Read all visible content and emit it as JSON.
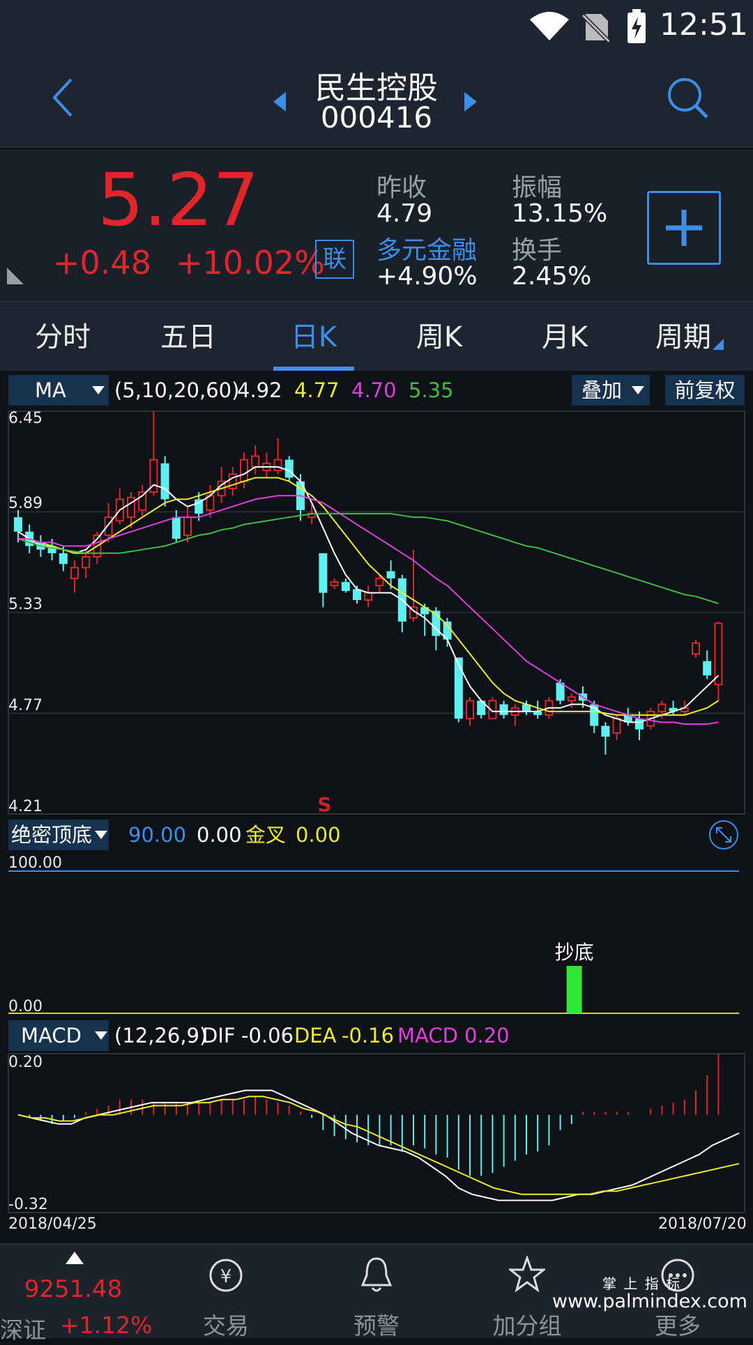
{
  "status": {
    "time": "12:51"
  },
  "header": {
    "stock_name": "民生控股",
    "stock_code": "000416"
  },
  "quote": {
    "price": "5.27",
    "change": "+0.48",
    "change_pct": "+10.02%",
    "lian_badge": "联",
    "prev_close_label": "昨收",
    "prev_close": "4.79",
    "amplitude_label": "振幅",
    "amplitude": "13.15%",
    "sector_label": "多元金融",
    "sector_pct": "+4.90%",
    "turnover_label": "换手",
    "turnover": "2.45%",
    "up_color": "#e0262b",
    "accent": "#3c8ee6"
  },
  "tabs": [
    "分时",
    "五日",
    "日K",
    "周K",
    "月K",
    "周期"
  ],
  "active_tab": "日K",
  "ma_bar": {
    "select": "MA",
    "params": "(5,10,20,60)",
    "ma5": "4.92",
    "ma10": "4.77",
    "ma20": "4.70",
    "ma60": "5.35",
    "overlay_button": "叠加",
    "rights_button": "前复权"
  },
  "main_axis": {
    "ticks": [
      "6.45",
      "5.89",
      "5.33",
      "4.77",
      "4.21"
    ]
  },
  "signal_marker": "S",
  "indicator_bar": {
    "select": "绝密顶底",
    "v1": "90.00",
    "v2": "0.00",
    "golden_cross_label": "金叉",
    "v3": "0.00",
    "axis_top": "100.00",
    "axis_bottom": "0.00",
    "buy_label": "抄底"
  },
  "macd_bar": {
    "select": "MACD",
    "params": "(12,26,9)",
    "dif_label": "DIF",
    "dif": "-0.06",
    "dea_label": "DEA",
    "dea": "-0.16",
    "macd_label": "MACD",
    "macd": "0.20",
    "axis_top": "0.20",
    "axis_bottom": "-0.32"
  },
  "date_range": {
    "start": "2018/04/25",
    "end": "2018/07/20"
  },
  "bottom_nav": {
    "index_value": "9251.48",
    "index_name": "深证",
    "index_pct": "+1.12%",
    "items": [
      "交易",
      "预警",
      "加分组",
      "更多"
    ]
  },
  "watermark": {
    "line1": "掌 上 指 标",
    "line2": "www.palmindex.com"
  },
  "chart_data": {
    "type": "candlestick",
    "ylim": [
      4.21,
      6.45
    ],
    "candles": [
      [
        5.86,
        5.78,
        5.9,
        5.72
      ],
      [
        5.78,
        5.7,
        5.82,
        5.66
      ],
      [
        5.72,
        5.68,
        5.76,
        5.64
      ],
      [
        5.7,
        5.66,
        5.74,
        5.62
      ],
      [
        5.66,
        5.6,
        5.7,
        5.56
      ],
      [
        5.52,
        5.58,
        5.62,
        5.44
      ],
      [
        5.58,
        5.64,
        5.68,
        5.52
      ],
      [
        5.64,
        5.76,
        5.78,
        5.6
      ],
      [
        5.76,
        5.86,
        5.94,
        5.72
      ],
      [
        5.84,
        5.96,
        6.02,
        5.82
      ],
      [
        5.86,
        5.97,
        6.0,
        5.8
      ],
      [
        5.9,
        6.0,
        6.04,
        5.86
      ],
      [
        6.0,
        6.18,
        6.45,
        5.98
      ],
      [
        6.16,
        5.96,
        6.2,
        5.92
      ],
      [
        5.86,
        5.74,
        5.9,
        5.72
      ],
      [
        5.76,
        5.86,
        5.92,
        5.72
      ],
      [
        5.96,
        5.88,
        6.0,
        5.84
      ],
      [
        5.9,
        5.98,
        6.04,
        5.86
      ],
      [
        5.98,
        6.06,
        6.14,
        5.94
      ],
      [
        6.02,
        6.1,
        6.14,
        5.98
      ],
      [
        6.06,
        6.18,
        6.22,
        6.02
      ],
      [
        6.14,
        6.2,
        6.26,
        6.1
      ],
      [
        6.12,
        6.16,
        6.22,
        6.08
      ],
      [
        6.12,
        6.18,
        6.3,
        6.1
      ],
      [
        6.18,
        6.08,
        6.2,
        6.06
      ],
      [
        6.06,
        5.9,
        6.1,
        5.84
      ],
      [
        5.86,
        5.88,
        5.94,
        5.82
      ],
      [
        5.66,
        5.44,
        5.66,
        5.36
      ],
      [
        5.48,
        5.5,
        5.52,
        5.46
      ],
      [
        5.5,
        5.45,
        5.52,
        5.44
      ],
      [
        5.46,
        5.4,
        5.48,
        5.38
      ],
      [
        5.4,
        5.44,
        5.48,
        5.36
      ],
      [
        5.48,
        5.52,
        5.54,
        5.44
      ],
      [
        5.56,
        5.52,
        5.62,
        5.46
      ],
      [
        5.52,
        5.28,
        5.54,
        5.22
      ],
      [
        5.3,
        5.36,
        5.68,
        5.28
      ],
      [
        5.36,
        5.32,
        5.38,
        5.2
      ],
      [
        5.34,
        5.2,
        5.36,
        5.12
      ],
      [
        5.28,
        5.18,
        5.3,
        5.14
      ],
      [
        5.08,
        4.74,
        5.08,
        4.72
      ],
      [
        4.74,
        4.84,
        4.86,
        4.7
      ],
      [
        4.84,
        4.76,
        4.84,
        4.74
      ],
      [
        4.74,
        4.84,
        4.86,
        4.74
      ],
      [
        4.82,
        4.76,
        4.84,
        4.74
      ],
      [
        4.76,
        4.8,
        4.82,
        4.7
      ],
      [
        4.82,
        4.78,
        4.84,
        4.76
      ],
      [
        4.78,
        4.76,
        4.84,
        4.74
      ],
      [
        4.76,
        4.84,
        4.86,
        4.74
      ],
      [
        4.94,
        4.84,
        4.96,
        4.82
      ],
      [
        4.84,
        4.86,
        4.88,
        4.8
      ],
      [
        4.88,
        4.84,
        4.92,
        4.8
      ],
      [
        4.82,
        4.7,
        4.84,
        4.66
      ],
      [
        4.7,
        4.64,
        4.72,
        4.54
      ],
      [
        4.66,
        4.74,
        4.76,
        4.62
      ],
      [
        4.76,
        4.72,
        4.8,
        4.7
      ],
      [
        4.74,
        4.68,
        4.78,
        4.62
      ],
      [
        4.7,
        4.78,
        4.8,
        4.68
      ],
      [
        4.78,
        4.82,
        4.84,
        4.74
      ],
      [
        4.8,
        4.78,
        4.84,
        4.76
      ],
      [
        4.78,
        4.8,
        4.84,
        4.76
      ],
      [
        5.1,
        5.16,
        5.18,
        5.08
      ],
      [
        5.06,
        4.98,
        5.12,
        4.96
      ],
      [
        4.93,
        5.27,
        5.28,
        4.84
      ]
    ],
    "ma5": [
      5.78,
      5.74,
      5.7,
      5.7,
      5.68,
      5.66,
      5.68,
      5.74,
      5.82,
      5.9,
      5.94,
      5.98,
      6.04,
      6.02,
      5.96,
      5.92,
      5.94,
      5.98,
      6.04,
      6.08,
      6.1,
      6.14,
      6.14,
      6.14,
      6.12,
      6.06,
      5.94,
      5.8,
      5.66,
      5.54,
      5.46,
      5.44,
      5.44,
      5.44,
      5.4,
      5.34,
      5.3,
      5.24,
      5.18,
      5.04,
      4.92,
      4.84,
      4.78,
      4.78,
      4.78,
      4.78,
      4.78,
      4.8,
      4.8,
      4.82,
      4.82,
      4.8,
      4.76,
      4.74,
      4.72,
      4.72,
      4.74,
      4.76,
      4.78,
      4.8,
      4.86,
      4.92,
      4.98
    ],
    "ma10": [
      5.74,
      5.74,
      5.72,
      5.7,
      5.68,
      5.66,
      5.66,
      5.7,
      5.74,
      5.78,
      5.82,
      5.86,
      5.9,
      5.94,
      5.96,
      5.96,
      5.98,
      6.0,
      6.02,
      6.04,
      6.06,
      6.08,
      6.08,
      6.08,
      6.06,
      6.02,
      5.98,
      5.92,
      5.84,
      5.76,
      5.68,
      5.6,
      5.54,
      5.48,
      5.44,
      5.4,
      5.36,
      5.32,
      5.26,
      5.18,
      5.1,
      5.02,
      4.94,
      4.88,
      4.84,
      4.82,
      4.8,
      4.78,
      4.78,
      4.78,
      4.78,
      4.78,
      4.77,
      4.76,
      4.76,
      4.76,
      4.76,
      4.76,
      4.76,
      4.76,
      4.78,
      4.8,
      4.84
    ],
    "ma20": [
      5.74,
      5.74,
      5.72,
      5.72,
      5.7,
      5.7,
      5.7,
      5.72,
      5.74,
      5.76,
      5.78,
      5.8,
      5.82,
      5.84,
      5.86,
      5.86,
      5.86,
      5.88,
      5.9,
      5.92,
      5.94,
      5.96,
      5.97,
      5.98,
      5.98,
      5.98,
      5.96,
      5.94,
      5.9,
      5.86,
      5.82,
      5.78,
      5.74,
      5.7,
      5.66,
      5.62,
      5.57,
      5.52,
      5.48,
      5.42,
      5.36,
      5.3,
      5.24,
      5.18,
      5.12,
      5.06,
      5.02,
      4.98,
      4.94,
      4.9,
      4.86,
      4.82,
      4.8,
      4.78,
      4.76,
      4.74,
      4.73,
      4.72,
      4.72,
      4.71,
      4.71,
      4.71,
      4.72
    ],
    "ma60": [
      5.74,
      5.72,
      5.7,
      5.69,
      5.68,
      5.67,
      5.66,
      5.66,
      5.66,
      5.66,
      5.67,
      5.68,
      5.69,
      5.7,
      5.72,
      5.74,
      5.76,
      5.77,
      5.79,
      5.8,
      5.82,
      5.83,
      5.84,
      5.85,
      5.86,
      5.87,
      5.88,
      5.88,
      5.88,
      5.88,
      5.88,
      5.88,
      5.88,
      5.88,
      5.87,
      5.86,
      5.86,
      5.85,
      5.84,
      5.82,
      5.8,
      5.78,
      5.76,
      5.74,
      5.72,
      5.7,
      5.69,
      5.67,
      5.65,
      5.63,
      5.61,
      5.59,
      5.57,
      5.55,
      5.53,
      5.51,
      5.49,
      5.47,
      5.45,
      5.43,
      5.42,
      5.4,
      5.38
    ],
    "signal_index": 62,
    "buy_signal_index": 48,
    "macd_ylim": [
      -0.32,
      0.2
    ],
    "macd_hist": [
      0.0,
      -0.01,
      -0.02,
      -0.03,
      -0.02,
      -0.01,
      0.01,
      0.02,
      0.03,
      0.05,
      0.05,
      0.05,
      0.04,
      0.04,
      0.04,
      0.04,
      0.04,
      0.04,
      0.05,
      0.05,
      0.05,
      0.06,
      0.05,
      0.04,
      0.03,
      0.01,
      -0.01,
      -0.05,
      -0.07,
      -0.08,
      -0.09,
      -0.1,
      -0.1,
      -0.1,
      -0.12,
      -0.1,
      -0.11,
      -0.13,
      -0.14,
      -0.18,
      -0.2,
      -0.2,
      -0.19,
      -0.17,
      -0.15,
      -0.13,
      -0.12,
      -0.1,
      -0.05,
      -0.03,
      0.01,
      0.01,
      0.01,
      0.01,
      0.01,
      0.0,
      0.02,
      0.03,
      0.04,
      0.05,
      0.08,
      0.13,
      0.2
    ],
    "dif": [
      0.0,
      -0.01,
      -0.02,
      -0.03,
      -0.03,
      -0.01,
      0.0,
      0.01,
      0.02,
      0.03,
      0.04,
      0.04,
      0.04,
      0.04,
      0.05,
      0.06,
      0.07,
      0.08,
      0.08,
      0.08,
      0.06,
      0.04,
      0.02,
      0.0,
      -0.03,
      -0.06,
      -0.08,
      -0.1,
      -0.11,
      -0.12,
      -0.14,
      -0.17,
      -0.2,
      -0.24,
      -0.26,
      -0.27,
      -0.28,
      -0.28,
      -0.28,
      -0.28,
      -0.28,
      -0.27,
      -0.26,
      -0.26,
      -0.25,
      -0.24,
      -0.23,
      -0.21,
      -0.19,
      -0.17,
      -0.15,
      -0.13,
      -0.1,
      -0.08,
      -0.06
    ],
    "dea": [
      0.0,
      -0.01,
      -0.01,
      -0.02,
      -0.02,
      -0.01,
      0.0,
      0.0,
      0.01,
      0.02,
      0.03,
      0.03,
      0.03,
      0.04,
      0.04,
      0.05,
      0.05,
      0.06,
      0.06,
      0.05,
      0.04,
      0.02,
      0.01,
      -0.01,
      -0.03,
      -0.04,
      -0.06,
      -0.08,
      -0.1,
      -0.12,
      -0.14,
      -0.16,
      -0.18,
      -0.2,
      -0.22,
      -0.24,
      -0.25,
      -0.26,
      -0.26,
      -0.26,
      -0.26,
      -0.26,
      -0.26,
      -0.25,
      -0.25,
      -0.24,
      -0.23,
      -0.22,
      -0.21,
      -0.2,
      -0.19,
      -0.18,
      -0.17,
      -0.16
    ]
  }
}
